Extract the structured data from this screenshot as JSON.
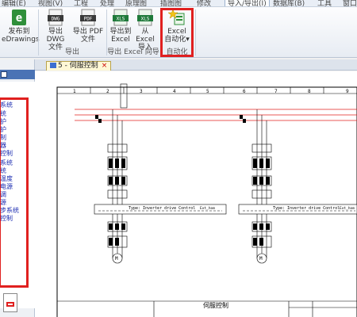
{
  "menubar": {
    "items": [
      "编辑(E)",
      "视图(V)",
      "工程",
      "处理",
      "原理图",
      "插图图",
      "修改",
      "导入/导出(I)",
      "数据库(B)",
      "工具",
      "窗口"
    ],
    "active_index": 7
  },
  "ribbon": {
    "publish": {
      "line1": "发布到",
      "line2": "eDrawings"
    },
    "export_dwg": {
      "line1": "导出 DWG",
      "line2": "文件"
    },
    "export_pdf": {
      "line1": "导出 PDF",
      "line2": "文件"
    },
    "export_group_label": "导出",
    "export_excel": {
      "line1": "导出到",
      "line2": "Excel"
    },
    "import_excel": {
      "line1": "从 Excel",
      "line2": "导入"
    },
    "excel_group_label": "导出 Excel 向导",
    "excel_auto": {
      "line1": "Excel",
      "line2": "自动化"
    },
    "auto_group_label": "自动化",
    "icon_labels": {
      "dwg": "DWG",
      "pdf": "PDF",
      "xls1": "XLS",
      "xls2": "XLS"
    }
  },
  "left_panel": {
    "items": [
      "系统",
      "统",
      "护",
      "护",
      "制",
      "器",
      "控制",
      "系统",
      "统",
      "温度",
      "电源",
      "调",
      "源",
      "步系统",
      "控制"
    ]
  },
  "doc_tab": {
    "label": "5 - 伺服控制"
  },
  "drawing": {
    "column_numbers": [
      "1",
      "2",
      "3",
      "4",
      "5",
      "6",
      "7",
      "8",
      "9"
    ],
    "left_block": {
      "drive_text": "Inverter drive Control",
      "type_label": "Type:",
      "coil_label": "Ext_hom"
    },
    "right_block": {
      "drive_text": "Inverter drive Control",
      "type_label": "Type:",
      "coil_label": "Ext_hom"
    },
    "motor_label": "M",
    "title_block": {
      "title": "伺服控制"
    }
  },
  "colors": {
    "highlight": "#e0201f",
    "accent": "#4a73b5",
    "wire_red": "#e0201f"
  }
}
